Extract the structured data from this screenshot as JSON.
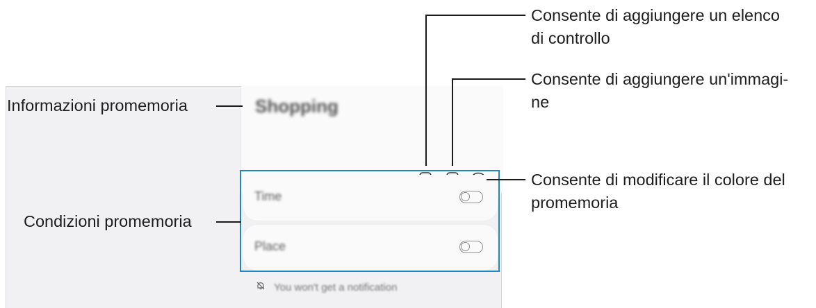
{
  "memo": {
    "title": "Shopping"
  },
  "toolbar": {
    "icons": [
      "checklist-icon",
      "image-icon",
      "palette-icon"
    ]
  },
  "conditions": [
    {
      "label": "Time",
      "toggle_on": false
    },
    {
      "label": "Place",
      "toggle_on": false
    }
  ],
  "notification": {
    "text": "You won't get a notification"
  },
  "callouts": {
    "info": "Informazioni promemoria",
    "conditions": "Condizioni promemoria",
    "checklist_line1": "Consente di aggiungere un elenco",
    "checklist_line2": "di controllo",
    "image_line1": "Consente di aggiungere un'immagi-",
    "image_line2": "ne",
    "color_line1": "Consente di modificare il colore del",
    "color_line2": "promemoria"
  },
  "colors": {
    "highlight": "#1e88c7",
    "card": "#fafafa",
    "screen_bg": "#f1f1f3"
  }
}
